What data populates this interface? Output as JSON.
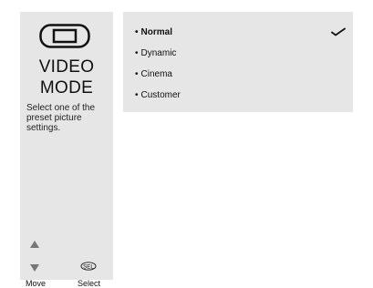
{
  "sidebar": {
    "icon": "tv-icon",
    "title_line1": "VIDEO",
    "title_line2": "MODE",
    "description": "Select one of the preset picture settings.",
    "nav": {
      "move_icon": "up-down-arrows-icon",
      "move_label": "Move",
      "select_icon": "sel-button-icon",
      "select_label": "Select"
    }
  },
  "menu": {
    "bullet": "•",
    "options": [
      {
        "label": "Normal",
        "selected": true
      },
      {
        "label": "Dynamic",
        "selected": false
      },
      {
        "label": "Cinema",
        "selected": false
      },
      {
        "label": "Customer",
        "selected": false
      }
    ],
    "check_icon": "checkmark-icon"
  }
}
